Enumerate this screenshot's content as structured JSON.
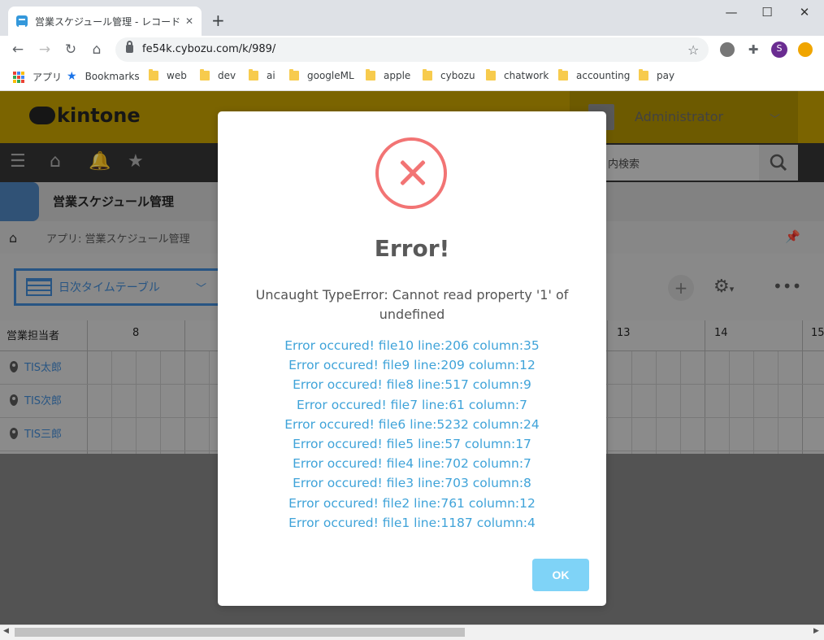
{
  "browser": {
    "tab_title": "営業スケジュール管理 - レコードの一覧",
    "tab_close": "✕",
    "new_tab": "+",
    "window_controls": {
      "minimize": "—",
      "maximize": "☐",
      "close": "✕"
    },
    "url": "fe54k.cybozu.com/k/989/",
    "profile_initial": "S",
    "bookmarks": [
      {
        "label": "アプリ",
        "icon": "apps-grid-icon"
      },
      {
        "label": "Bookmarks",
        "icon": "star-icon"
      },
      {
        "label": "web",
        "icon": "folder-icon"
      },
      {
        "label": "dev",
        "icon": "folder-icon"
      },
      {
        "label": "ai",
        "icon": "folder-icon"
      },
      {
        "label": "googleML",
        "icon": "folder-icon"
      },
      {
        "label": "apple",
        "icon": "folder-icon"
      },
      {
        "label": "cybozu",
        "icon": "folder-icon"
      },
      {
        "label": "chatwork",
        "icon": "folder-icon"
      },
      {
        "label": "accounting",
        "icon": "folder-icon"
      },
      {
        "label": "pay",
        "icon": "folder-icon"
      }
    ]
  },
  "kintone": {
    "logo_text": "kintone",
    "user_name": "Administrator",
    "search_placeholder": "リ内検索",
    "app_name": "営業スケジュール管理",
    "breadcrumb": "アプリ: 営業スケジュール管理",
    "view_name": "日次タイムテーブル",
    "grid": {
      "owner_header": "営業担当者",
      "hours": [
        "8",
        "13",
        "14",
        "15"
      ],
      "rows": [
        "TIS太郎",
        "TIS次郎",
        "TIS三郎"
      ]
    }
  },
  "dialog": {
    "title": "Error!",
    "message": "Uncaught TypeError: Cannot read property '1' of undefined",
    "trace": [
      "Error occured! file10 line:206 column:35",
      "Error occured! file9 line:209 column:12",
      "Error occured! file8 line:517 column:9",
      "Error occured! file7 line:61 column:7",
      "Error occured! file6 line:5232 column:24",
      "Error occured! file5 line:57 column:17",
      "Error occured! file4 line:702 column:7",
      "Error occured! file3 line:703 column:8",
      "Error occured! file2 line:761 column:12",
      "Error occured! file1 line:1187 column:4"
    ],
    "ok_label": "OK"
  },
  "colors": {
    "kintone_header": "#bd9a00",
    "error_red": "#f27474",
    "link_blue": "#3fa3d9",
    "ok_button": "#7fd3f7"
  }
}
